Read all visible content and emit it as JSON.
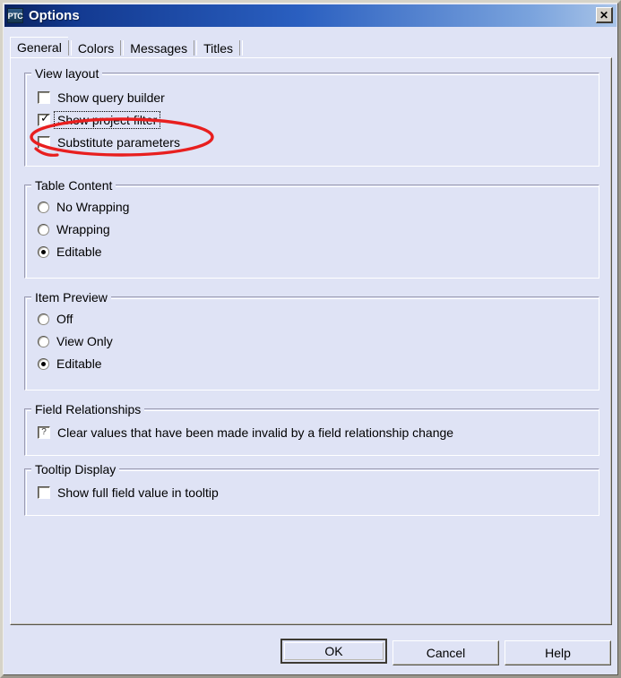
{
  "window": {
    "title": "Options",
    "logo_text": "PTC",
    "close_label": "✕"
  },
  "tabs": [
    {
      "label": "General",
      "active": true
    },
    {
      "label": "Colors",
      "active": false
    },
    {
      "label": "Messages",
      "active": false
    },
    {
      "label": "Titles",
      "active": false
    }
  ],
  "groups": {
    "view_layout": {
      "title": "View layout",
      "options": [
        {
          "label": "Show query builder",
          "checked": false,
          "focused": false
        },
        {
          "label": "Show project filter",
          "checked": true,
          "focused": true
        },
        {
          "label": "Substitute parameters",
          "checked": false,
          "focused": false
        }
      ]
    },
    "table_content": {
      "title": "Table Content",
      "options": [
        {
          "label": "No Wrapping",
          "selected": false
        },
        {
          "label": "Wrapping",
          "selected": false
        },
        {
          "label": "Editable",
          "selected": true
        }
      ]
    },
    "item_preview": {
      "title": "Item Preview",
      "options": [
        {
          "label": "Off",
          "selected": false
        },
        {
          "label": "View Only",
          "selected": false
        },
        {
          "label": "Editable",
          "selected": true
        }
      ]
    },
    "field_relationships": {
      "title": "Field Relationships",
      "options": [
        {
          "label": "Clear values that have been made invalid by a field relationship change",
          "state": "indeterminate",
          "state_glyph": "?"
        }
      ]
    },
    "tooltip_display": {
      "title": "Tooltip Display",
      "options": [
        {
          "label": "Show full field value in tooltip",
          "checked": false
        }
      ]
    }
  },
  "buttons": {
    "ok": "OK",
    "cancel": "Cancel",
    "help": "Help"
  },
  "annotation": {
    "type": "red-ellipse-highlight",
    "target": "Show project filter",
    "color": "#e81f1f"
  },
  "colors": {
    "dialog_background": "#dfe3f5",
    "titlebar_start": "#0a2260",
    "titlebar_end": "#a9c4e8",
    "frame": "#d6d3c8",
    "text": "#000000",
    "annotation_red": "#e81f1f"
  }
}
